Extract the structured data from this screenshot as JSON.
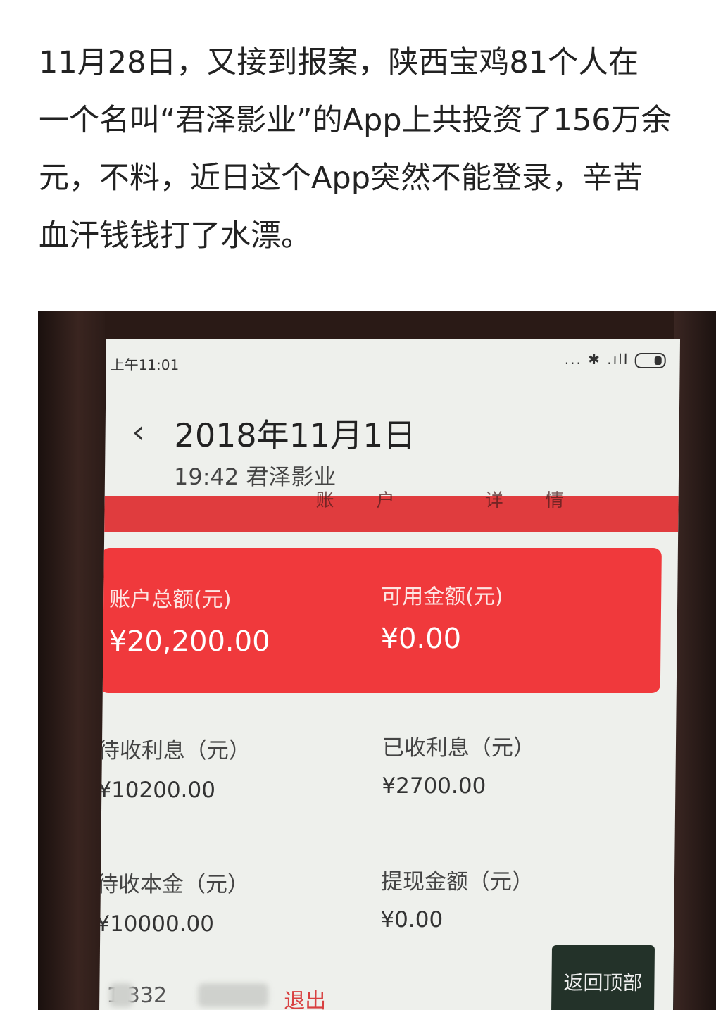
{
  "article": {
    "lines": [
      "11月28日，又接到报案，陕西宝鸡81个人在",
      "一个名叫“君泽影业”的App上共投资了156万余",
      "元，不料，近日这个App突然不能登录，辛苦",
      "血汗钱钱打了水漂。"
    ]
  },
  "phone": {
    "status_time": "上午11:01",
    "status_icons": "... ✱ .ıll",
    "nav": {
      "back_glyph": "‹",
      "date": "2018年11月1日",
      "subtitle": "19:42  君泽影业"
    },
    "strip_text": "账户 详情",
    "card": {
      "total_label": "账户总额(元)",
      "total_value": "¥20,200.00",
      "available_label": "可用金额(元)",
      "available_value": "¥0.00"
    },
    "details": {
      "pending_interest_label": "待收利息（元）",
      "pending_interest_value": "¥10200.00",
      "received_interest_label": "已收利息（元）",
      "received_interest_value": "¥2700.00",
      "pending_principal_label": "待收本金（元）",
      "pending_principal_value": "¥10000.00",
      "withdraw_label": "提现金额（元）",
      "withdraw_value": "¥0.00"
    },
    "bottom": {
      "phone_number_partial": "1  332",
      "logout": "退出",
      "back_to_top": "返回顶部"
    }
  },
  "colors": {
    "card_red": "#f0393c",
    "strip_red": "#e03c3e",
    "back_top_bg": "#233229"
  }
}
